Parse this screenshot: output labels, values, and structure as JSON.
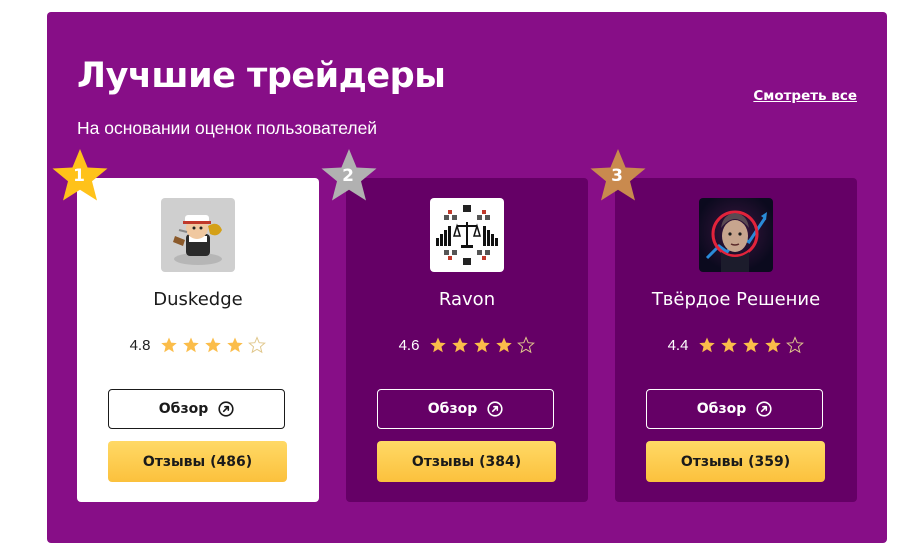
{
  "colors": {
    "panel_bg": "#870e87",
    "card_dark_bg": "#650066",
    "gold": "#ffc21a",
    "silver": "#b1b1b1",
    "bronze": "#c98a4e",
    "star_fill": "#fbbd4a",
    "button_yellow": "#fcc744"
  },
  "header": {
    "title": "Лучшие трейдеры",
    "subtitle": "На основании оценок пользователей",
    "view_all": "Смотреть все"
  },
  "cards": [
    {
      "rank": "1",
      "rank_badge": "gold-star-icon",
      "name": "Duskedge",
      "rating": "4.8",
      "stars": 4,
      "review_label": "Обзор",
      "review_icon": "external-link-circle-icon",
      "reviews_label": "Отзывы (486)"
    },
    {
      "rank": "2",
      "rank_badge": "silver-star-icon",
      "name": "Ravon",
      "rating": "4.6",
      "stars": 4,
      "review_label": "Обзор",
      "review_icon": "external-link-circle-icon",
      "reviews_label": "Отзывы (384)"
    },
    {
      "rank": "3",
      "rank_badge": "bronze-star-icon",
      "name": "Твёрдое Решение",
      "rating": "4.4",
      "stars": 4,
      "review_label": "Обзор",
      "review_icon": "external-link-circle-icon",
      "reviews_label": "Отзывы (359)"
    }
  ]
}
